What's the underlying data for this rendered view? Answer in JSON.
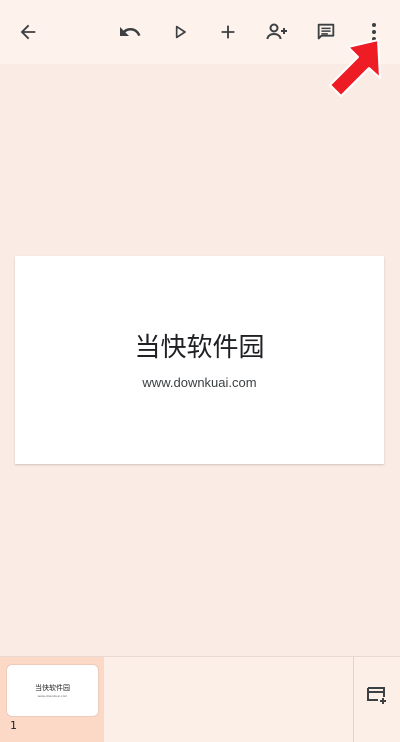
{
  "toolbar": {
    "icons": [
      "back-arrow-icon",
      "undo-icon",
      "play-icon",
      "plus-icon",
      "add-person-icon",
      "comment-icon",
      "more-vert-icon"
    ]
  },
  "slide": {
    "title": "当快软件园",
    "subtitle": "www.downkuai.com"
  },
  "filmstrip": {
    "thumbnails": [
      {
        "title": "当快软件园",
        "subtitle": "www.downkuai.com",
        "number": "1"
      }
    ]
  },
  "colors": {
    "toolbar_bg": "#fdf2ec",
    "canvas_bg": "#faece5",
    "selected_thumb_bg": "#fcd9c7",
    "icon": "#3c4043",
    "pointer_arrow": "#ee1c25"
  }
}
